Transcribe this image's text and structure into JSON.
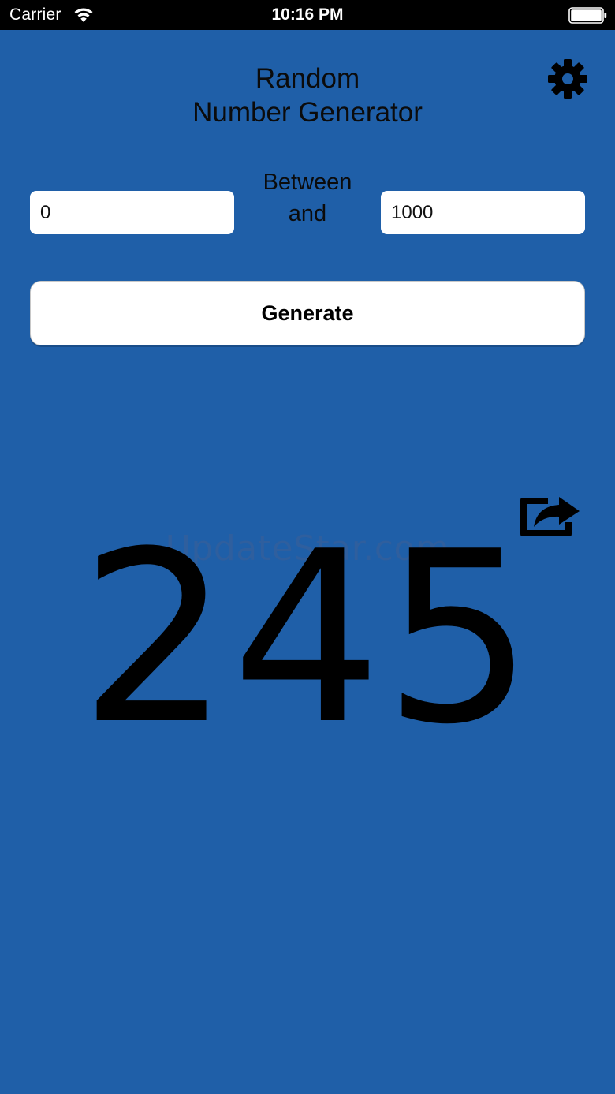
{
  "status_bar": {
    "carrier": "Carrier",
    "time": "10:16 PM",
    "wifi_icon": "wifi-icon",
    "battery_icon": "battery-icon"
  },
  "header": {
    "title_line1": "Random",
    "title_line2": "Number Generator",
    "settings_icon": "gear-icon"
  },
  "range": {
    "min_value": "0",
    "between_line1": "Between",
    "between_line2": "and",
    "max_value": "1000"
  },
  "generate_button_label": "Generate",
  "share_icon": "share-icon",
  "result": "245",
  "watermark": "UpdateStar.com",
  "colors": {
    "background": "#1F5FA8",
    "status_bar": "#000000",
    "text": "#000000"
  }
}
